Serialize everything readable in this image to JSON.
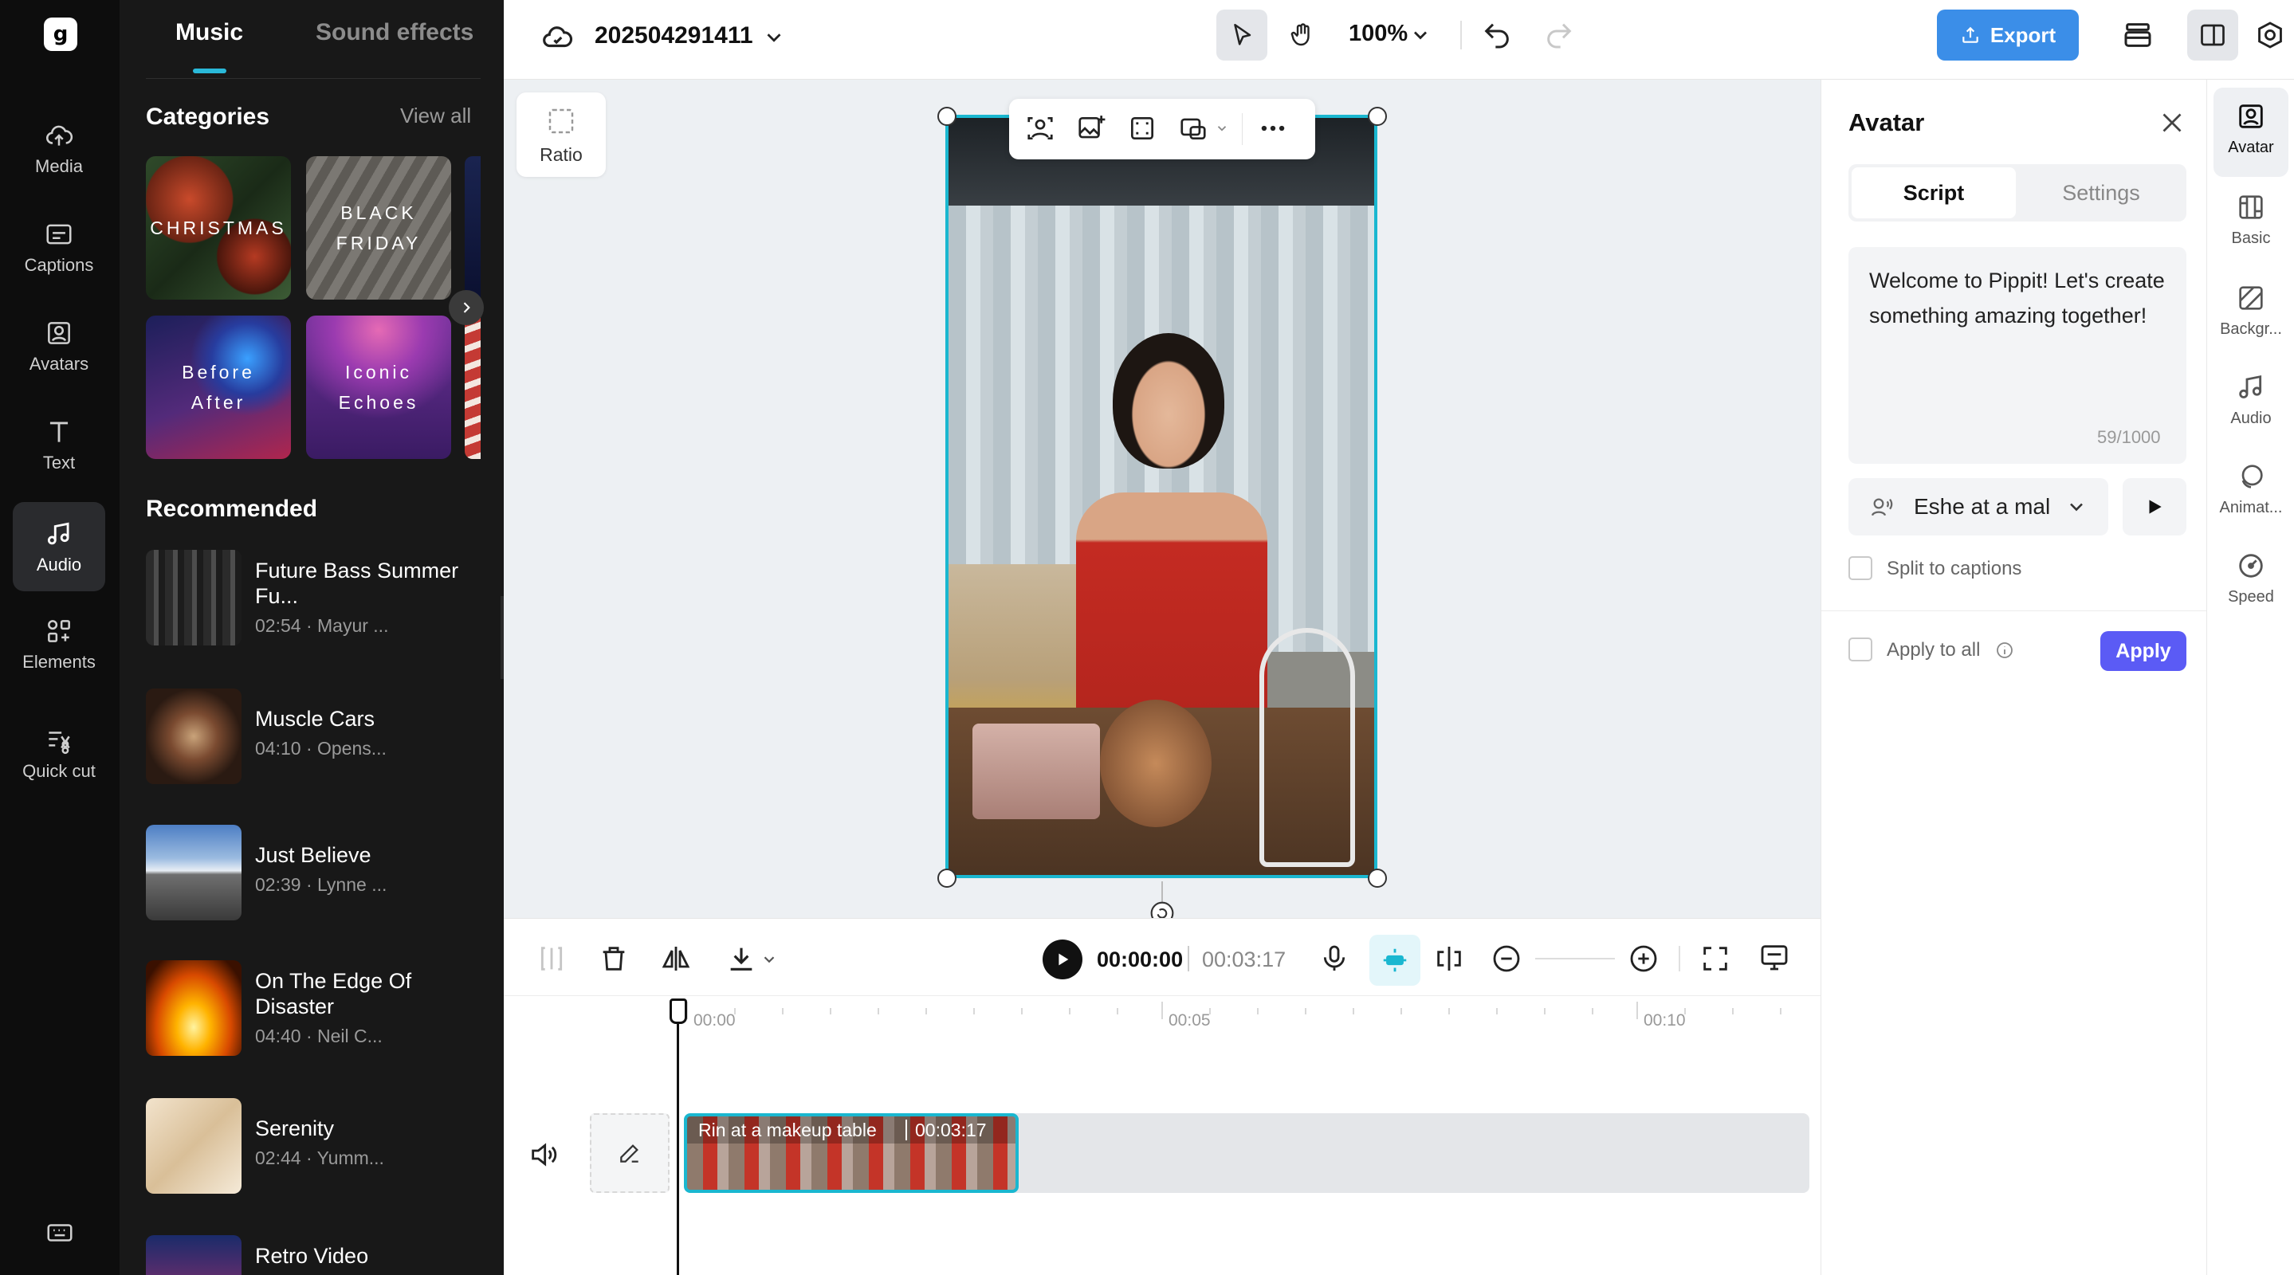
{
  "sidebar": {
    "logo": "g",
    "items": [
      {
        "label": "Media",
        "icon": "cloud-upload-icon"
      },
      {
        "label": "Captions",
        "icon": "captions-icon"
      },
      {
        "label": "Avatars",
        "icon": "avatar-icon"
      },
      {
        "label": "Text",
        "icon": "text-icon"
      },
      {
        "label": "Audio",
        "icon": "music-note-icon",
        "active": true
      },
      {
        "label": "Elements",
        "icon": "elements-icon"
      },
      {
        "label": "Quick cut",
        "icon": "quick-cut-icon"
      }
    ],
    "bottom_icon": "keyboard-icon"
  },
  "music_panel": {
    "tabs": [
      "Music",
      "Sound effects"
    ],
    "active_tab": "Music",
    "categories_title": "Categories",
    "view_all": "View all",
    "categories": [
      {
        "label": "CHRISTMAS"
      },
      {
        "label": "BLACK FRIDAY"
      },
      {
        "label": "Before After"
      },
      {
        "label": "Iconic Echoes"
      }
    ],
    "recommended_title": "Recommended",
    "recommended": [
      {
        "title": "Future Bass Summer Fu...",
        "meta": "02:54 · Mayur ..."
      },
      {
        "title": "Muscle Cars",
        "meta": "04:10 · Opens..."
      },
      {
        "title": "Just Believe",
        "meta": "02:39 · Lynne ..."
      },
      {
        "title": "On The Edge Of Disaster",
        "meta": "04:40 · Neil C..."
      },
      {
        "title": "Serenity",
        "meta": "02:44 · Yumm..."
      },
      {
        "title": "Retro Video",
        "meta": ""
      }
    ]
  },
  "topbar": {
    "project_name": "202504291411",
    "zoom": "100%",
    "export_label": "Export",
    "accent": "#3b8ee8"
  },
  "canvas": {
    "ratio_label": "Ratio"
  },
  "timeline": {
    "current_time": "00:00:00",
    "total_time": "00:03:17",
    "ruler": [
      "00:00",
      "00:05",
      "00:10"
    ],
    "clip_label": "Rin at a makeup table",
    "clip_duration": "00:03:17"
  },
  "avatar_panel": {
    "title": "Avatar",
    "tabs": [
      "Script",
      "Settings"
    ],
    "active_tab": "Script",
    "script_text": "Welcome to Pippit! Let's create something amazing together!",
    "char_count": "59/1000",
    "voice": "Eshe at a mal",
    "split_to_captions": "Split to captions",
    "apply_to_all": "Apply to all",
    "apply_button": "Apply",
    "apply_color": "#5b5bf5"
  },
  "right_rail": {
    "items": [
      {
        "label": "Avatar",
        "icon": "avatar-icon",
        "active": true
      },
      {
        "label": "Basic",
        "icon": "basic-icon"
      },
      {
        "label": "Backgr...",
        "icon": "background-icon"
      },
      {
        "label": "Audio",
        "icon": "music-note-icon"
      },
      {
        "label": "Animat...",
        "icon": "animation-icon"
      },
      {
        "label": "Speed",
        "icon": "speed-icon"
      }
    ]
  }
}
